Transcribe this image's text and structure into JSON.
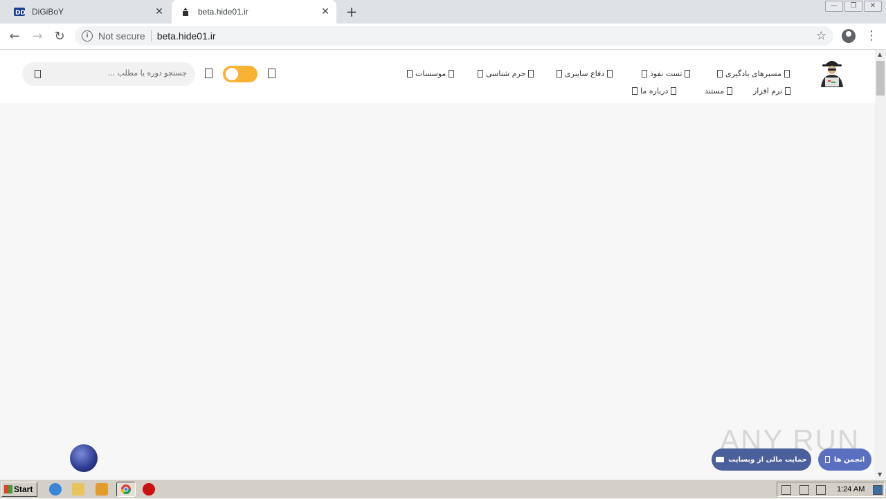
{
  "browser": {
    "tabs": [
      {
        "title": "DiGiBoY",
        "active": false
      },
      {
        "title": "beta.hide01.ir",
        "active": true
      }
    ],
    "new_tab_label": "+",
    "close_glyph": "✕",
    "address": {
      "security": "Not secure",
      "url": "beta.hide01.ir"
    }
  },
  "site": {
    "nav_row1": [
      {
        "label": "مسیرهای یادگیری"
      },
      {
        "label": "تست نفوذ"
      },
      {
        "label": "دفاع سایبری"
      },
      {
        "label": "جرم شناسی"
      },
      {
        "label": "موسسات"
      }
    ],
    "nav_row2": [
      {
        "label": "نرم افزار"
      },
      {
        "label": "مستند"
      },
      {
        "label": "درباره ما"
      }
    ],
    "search_placeholder": "جستجو دوره یا مطلب ...",
    "donate_button": "حمایت مالی از وبسایت",
    "forums_button": "انجمن ها",
    "toggle_accent": "#f9b233"
  },
  "watermark": "ANY RUN",
  "taskbar": {
    "start_label": "Start",
    "clock": "1:24 AM",
    "icons": [
      "ie-icon",
      "explorer-icon",
      "media-player-icon",
      "chrome-icon",
      "stop-icon"
    ]
  }
}
